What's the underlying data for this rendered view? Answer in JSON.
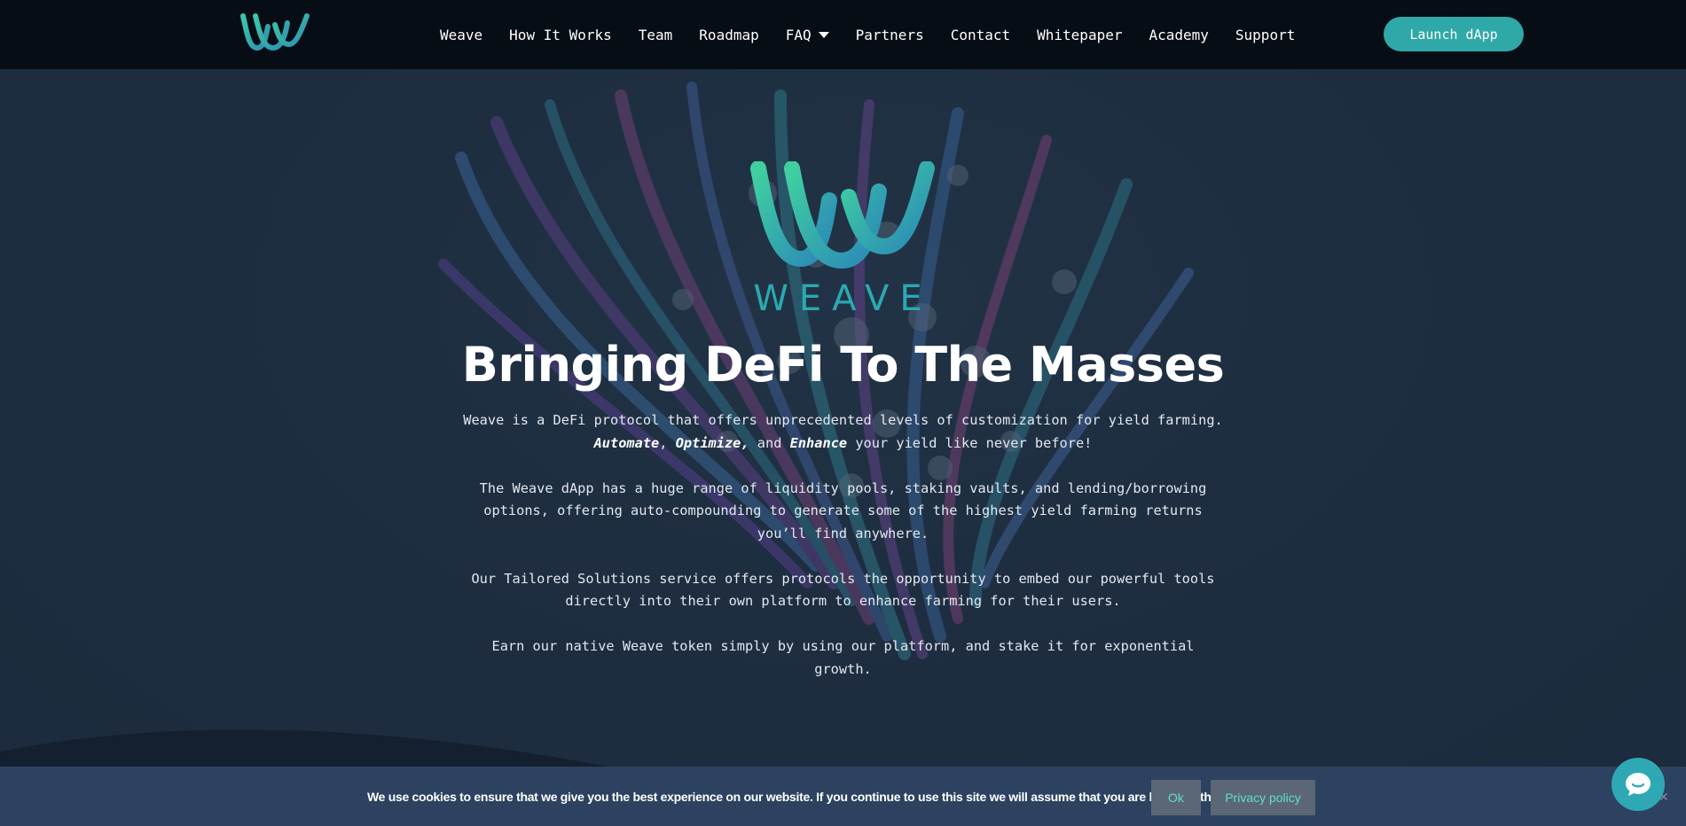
{
  "nav": {
    "items": [
      {
        "label": "Weave"
      },
      {
        "label": "How It Works"
      },
      {
        "label": "Team"
      },
      {
        "label": "Roadmap"
      },
      {
        "label": "FAQ"
      },
      {
        "label": "Partners"
      },
      {
        "label": "Contact"
      },
      {
        "label": "Whitepaper"
      },
      {
        "label": "Academy"
      },
      {
        "label": "Support"
      }
    ],
    "launch_label": "Launch dApp"
  },
  "hero": {
    "wordmark": "WEAVE",
    "title": "Bringing DeFi To The Masses",
    "p1_a": "Weave is a DeFi protocol that offers unprecedented levels of customization for yield farming.",
    "p1_b1": "Automate",
    "p1_sep1": ", ",
    "p1_b2": "Optimize,",
    "p1_sep2": " and ",
    "p1_b3": "Enhance",
    "p1_c": " your yield like never before!",
    "p2": "The Weave dApp has a huge range of liquidity pools, staking vaults, and lending/borrowing options, offering auto-compounding to generate some of the highest yield farming returns you’ll find anywhere.",
    "p3": "Our Tailored Solutions service offers protocols the opportunity to embed our powerful tools directly into their own platform to enhance farming for their users.",
    "p4": "Earn our native Weave token simply by using our platform, and stake it for exponential growth."
  },
  "cookie": {
    "text": "We use cookies to ensure that we give you the best experience on our website. If you continue to use this site we will assume that you are happy with it.",
    "ok_label": "Ok",
    "privacy_label": "Privacy policy",
    "close_label": "✕"
  },
  "colors": {
    "accent": "#2fa8a8",
    "nav_bg": "#060d14",
    "hero_bg": "#1f2d40",
    "cookie_bg": "#2c4260",
    "cookie_btn_text": "#5fe0c4"
  },
  "icons": [
    "weave-logo-icon",
    "chevron-down-icon",
    "chat-icon",
    "close-icon"
  ]
}
